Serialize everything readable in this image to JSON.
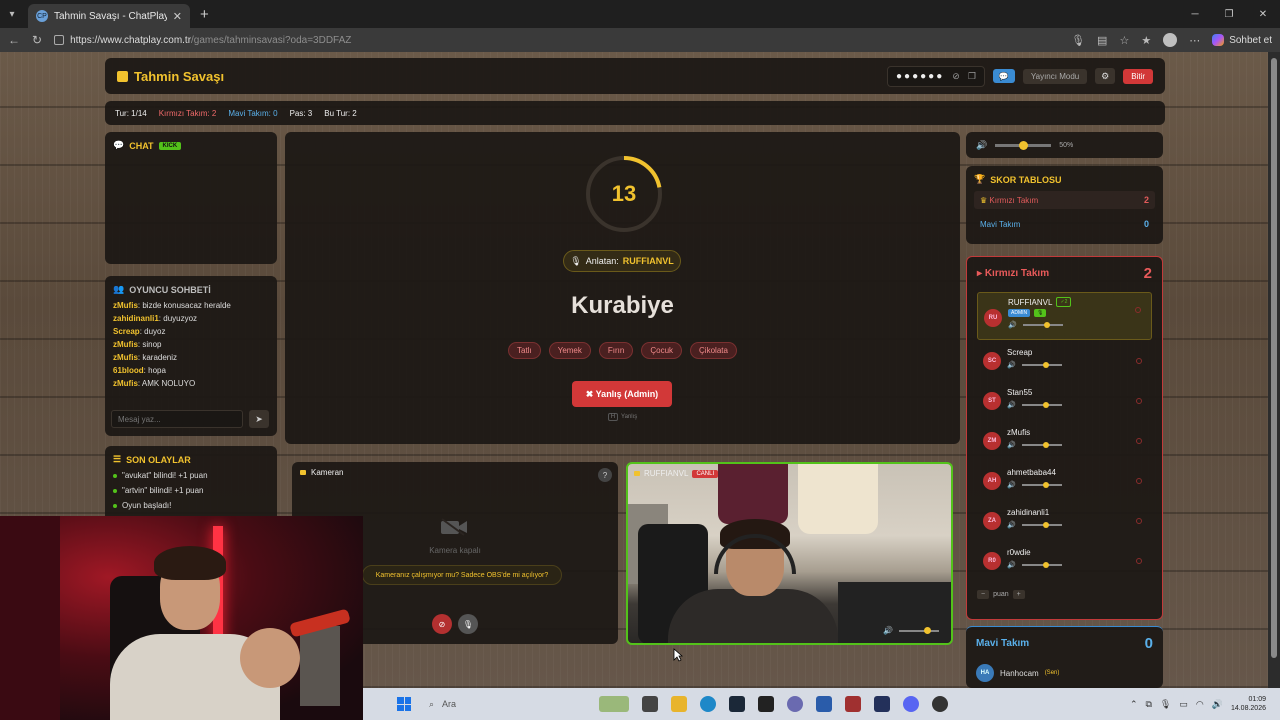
{
  "browser": {
    "tab_title": "Tahmin Savaşı - ChatPlay",
    "tab_favicon": "CP",
    "url_base": "https://www.chatplay.com.tr",
    "url_path": "/games/tahminsavasi?oda=3DDFAZ",
    "copilot_label": "Sohbet et"
  },
  "header": {
    "logo": "Tahmin Savaşı",
    "password_mask": "●●●●●●",
    "mode_label": "Yayıncı Modu",
    "end_label": "Bitir"
  },
  "status": {
    "round": "Tur: 1/14",
    "red_team": "Kırmızı Takım: 2",
    "blue_team": "Mavi Takım: 0",
    "pass": "Pas: 3",
    "this_round": "Bu Tur: 2"
  },
  "chat": {
    "title": "CHAT",
    "badge": "KICK"
  },
  "player_chat": {
    "title": "OYUNCU SOHBETİ",
    "messages": [
      {
        "user": "zMufis",
        "text": ": bizde konusacaz heralde"
      },
      {
        "user": "zahidinanli1",
        "text": ": duyuzyoz"
      },
      {
        "user": "Screap",
        "text": ": duyoz"
      },
      {
        "user": "zMufis",
        "text": ": sinop"
      },
      {
        "user": "zMufis",
        "text": ": karadeniz"
      },
      {
        "user": "61blood",
        "text": ": hopa"
      },
      {
        "user": "zMufis",
        "text": ": AMK NOLUYO"
      }
    ],
    "input_placeholder": "Mesaj yaz..."
  },
  "events": {
    "title": "SON OLAYLAR",
    "items": [
      "\"avukat\" bilindi! +1 puan",
      "\"artvin\" bilindi! +1 puan",
      "Oyun başladı!"
    ]
  },
  "game": {
    "timer": "13",
    "timer_progress": 0.22,
    "narrator_label": "Anlatan:",
    "narrator_name": "RUFFIANVL",
    "word": "Kurabiye",
    "taboos": [
      "Tatlı",
      "Yemek",
      "Fırın",
      "Çocuk",
      "Çikolata"
    ],
    "wrong_button": "✖ Yanlış (Admin)",
    "hint_key": "H",
    "hint_text": "Yanlış"
  },
  "my_camera": {
    "title": "Kameran",
    "off_text": "Kamera kapalı",
    "question": "Kameranız çalışmıyor mu? Sadece OBS'de mi açılıyor?"
  },
  "live_camera": {
    "name": "RUFFIANVL",
    "badge": "CANLI",
    "volume": 0.7
  },
  "volume": {
    "level": 0.5,
    "label": "50%"
  },
  "scoreboard": {
    "title": "SKOR TABLOSU",
    "red_name": "Kırmızı Takım",
    "red_score": "2",
    "blue_name": "Mavi Takım",
    "blue_score": "0"
  },
  "red_team": {
    "title": "Kırmızı Takım",
    "count": "2",
    "players": [
      {
        "initials": "RU",
        "name": "RUFFIANVL",
        "admin": "ADMIN",
        "verified": "✓2",
        "volume": 0.6
      },
      {
        "initials": "SC",
        "name": "Screap",
        "volume": 0.6
      },
      {
        "initials": "ST",
        "name": "Stan55",
        "volume": 0.6
      },
      {
        "initials": "ZM",
        "name": "zMufis",
        "volume": 0.6
      },
      {
        "initials": "AH",
        "name": "ahmetbaba44",
        "volume": 0.6
      },
      {
        "initials": "ZA",
        "name": "zahidinanli1",
        "volume": 0.6
      },
      {
        "initials": "R0",
        "name": "r0wdie",
        "volume": 0.6
      }
    ],
    "points_label": "puan"
  },
  "blue_team": {
    "title": "Mavi Takım",
    "count": "0",
    "players": [
      {
        "initials": "HA",
        "name": "Hanhocam",
        "tag": "(Sen)"
      }
    ]
  },
  "taskbar": {
    "search": "Ara",
    "time": "01:09",
    "date": "14.08.2026"
  }
}
